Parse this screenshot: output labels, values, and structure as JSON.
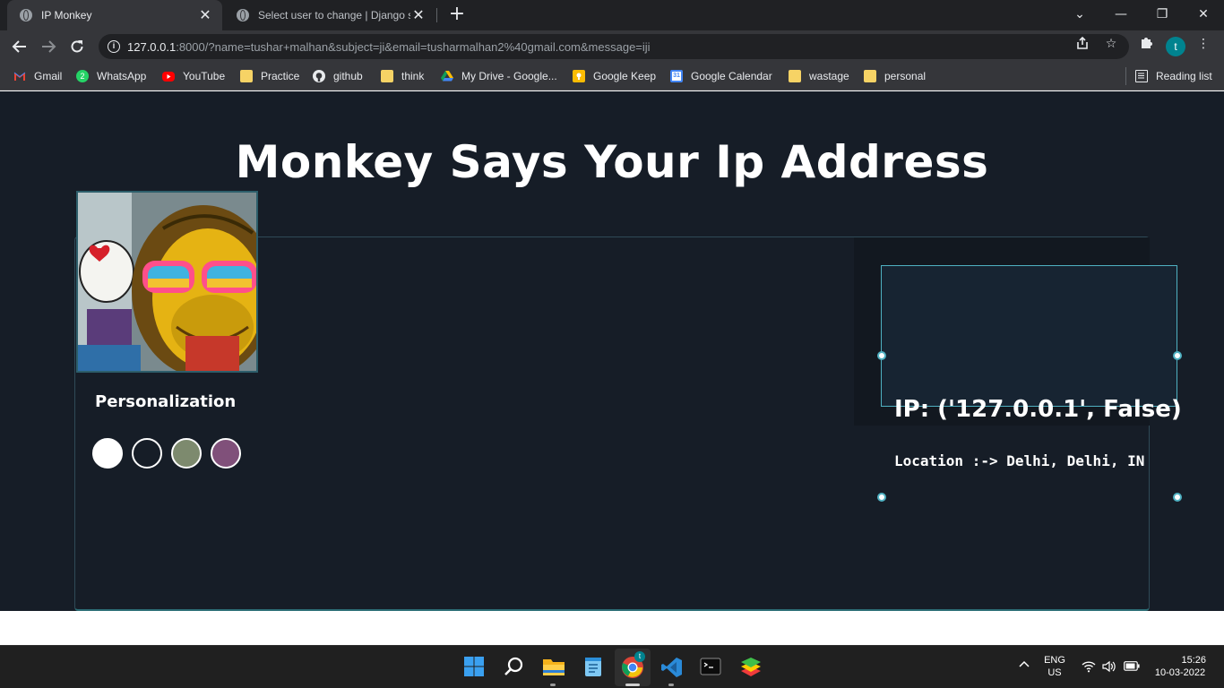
{
  "browser": {
    "tabs": [
      {
        "title": "IP Monkey",
        "active": true
      },
      {
        "title": "Select user to change | Django si",
        "active": false
      }
    ],
    "new_tab": "+",
    "window_controls": {
      "dropdown": "⌄",
      "minimize": "—",
      "restore": "❐",
      "close": "✕"
    },
    "url_host": "127.0.0.1",
    "url_rest": ":8000/?name=tushar+malhan&subject=ji&email=tusharmalhan2%40gmail.com&message=iji",
    "profile_initial": "t",
    "bookmarks": [
      {
        "label": "Gmail",
        "icon": "gmail-icon"
      },
      {
        "label": "WhatsApp",
        "icon": "whatsapp-icon"
      },
      {
        "label": "YouTube",
        "icon": "youtube-icon"
      },
      {
        "label": "Practice",
        "icon": "folder-icon"
      },
      {
        "label": "github",
        "icon": "github-icon"
      },
      {
        "label": "think",
        "icon": "folder-icon"
      },
      {
        "label": "My Drive - Google...",
        "icon": "google-drive-icon"
      },
      {
        "label": "Google Keep",
        "icon": "google-keep-icon"
      },
      {
        "label": "Google Calendar",
        "icon": "google-calendar-icon"
      },
      {
        "label": "wastage",
        "icon": "folder-icon"
      },
      {
        "label": "personal",
        "icon": "folder-icon"
      }
    ],
    "reading_list": "Reading list",
    "whatsapp_badge": "2",
    "calendar_day": "31"
  },
  "page": {
    "title": "Monkey Says Your Ip Address",
    "personalization_label": "Personalization",
    "swatches": [
      "#ffffff",
      "#161d27",
      "#7d8a6e",
      "#80507a"
    ],
    "ip_text": "IP: ('127.0.0.1', False)",
    "location_text": "Location :-> Delhi, Delhi, IN"
  },
  "taskbar": {
    "chrome_badge": "t",
    "language_line1": "ENG",
    "language_line2": "US",
    "time": "15:26",
    "date": "10-03-2022"
  },
  "colors": {
    "page_bg": "#161d27",
    "accent": "#4fb1c2",
    "chrome_dark": "#202124",
    "chrome_mid": "#35363a"
  }
}
